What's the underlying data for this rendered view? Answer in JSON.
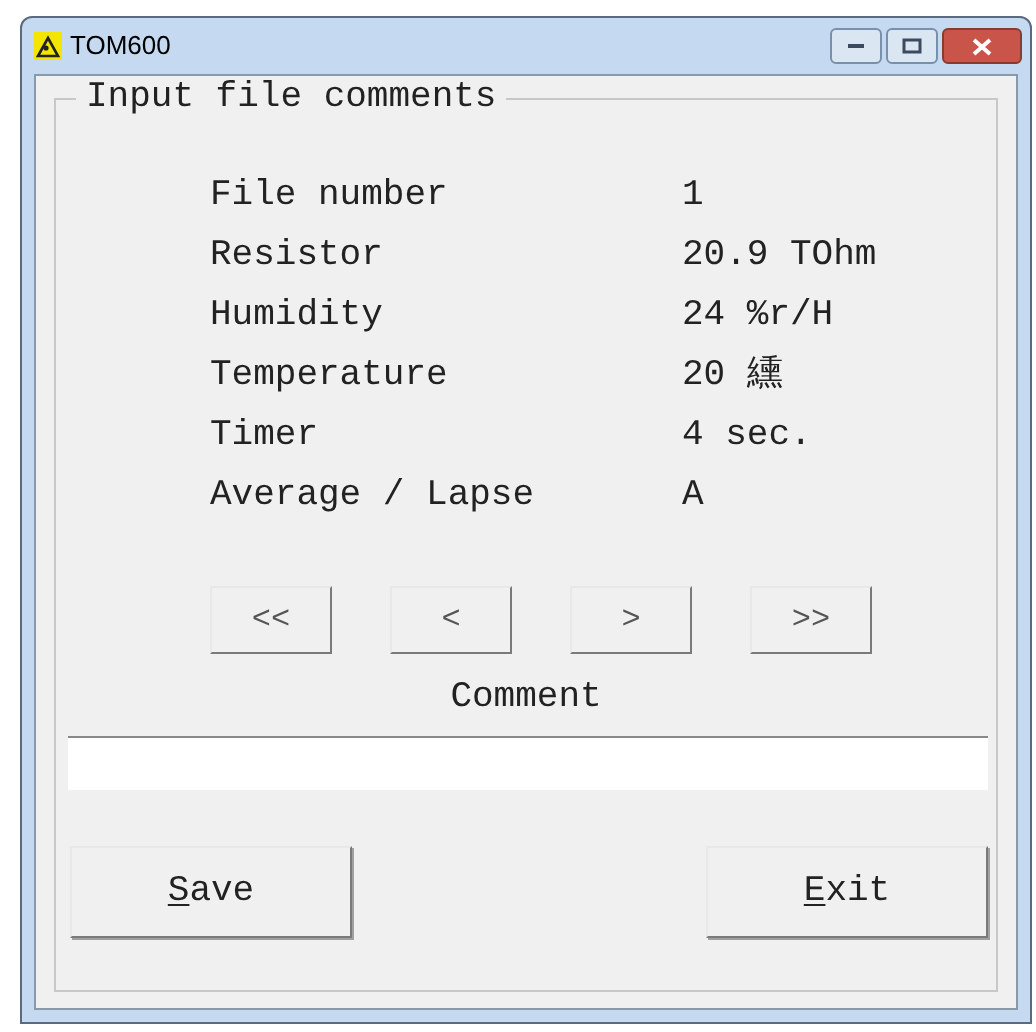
{
  "window": {
    "title": "TOM600"
  },
  "group": {
    "title": "Input file comments"
  },
  "fields": [
    {
      "label": "File number",
      "value": "1"
    },
    {
      "label": "Resistor",
      "value": "20.9 TOhm"
    },
    {
      "label": "Humidity",
      "value": "24 %r/H"
    },
    {
      "label": "Temperature",
      "value": "20 纁"
    },
    {
      "label": "Timer",
      "value": "4 sec."
    },
    {
      "label": "Average / Lapse",
      "value": "A"
    }
  ],
  "nav_buttons": [
    {
      "label": "<<"
    },
    {
      "label": "<"
    },
    {
      "label": ">"
    },
    {
      "label": ">>"
    }
  ],
  "comment": {
    "label": "Comment"
  },
  "buttons": [
    {
      "label": "Save",
      "underline_first": true
    },
    {
      "label": "Exit",
      "underline_first": true
    }
  ]
}
